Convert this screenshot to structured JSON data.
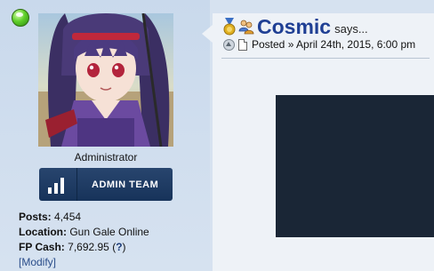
{
  "profile": {
    "status_icon": "online-green-dot-icon",
    "avatar_alt": "anime character avatar",
    "role_title": "Administrator",
    "team_button_label": "ADMIN TEAM",
    "stats": {
      "posts_label": "Posts:",
      "posts_value": "4,454",
      "location_label": "Location:",
      "location_value": "Gun Gale Online",
      "fp_cash_label": "FP Cash:",
      "fp_cash_value": "7,692.95",
      "fp_cash_help_open": "(",
      "fp_cash_help": "?",
      "fp_cash_help_close": ")",
      "modify_label": "[Modify]"
    }
  },
  "post": {
    "username": "Cosmic",
    "says": "says...",
    "meta": "Posted » April 24th, 2015, 6:00 pm"
  },
  "colors": {
    "sidebar_bg": "#d6e2f0",
    "button_bg": "#1c3a63",
    "username": "#1f3f94"
  }
}
